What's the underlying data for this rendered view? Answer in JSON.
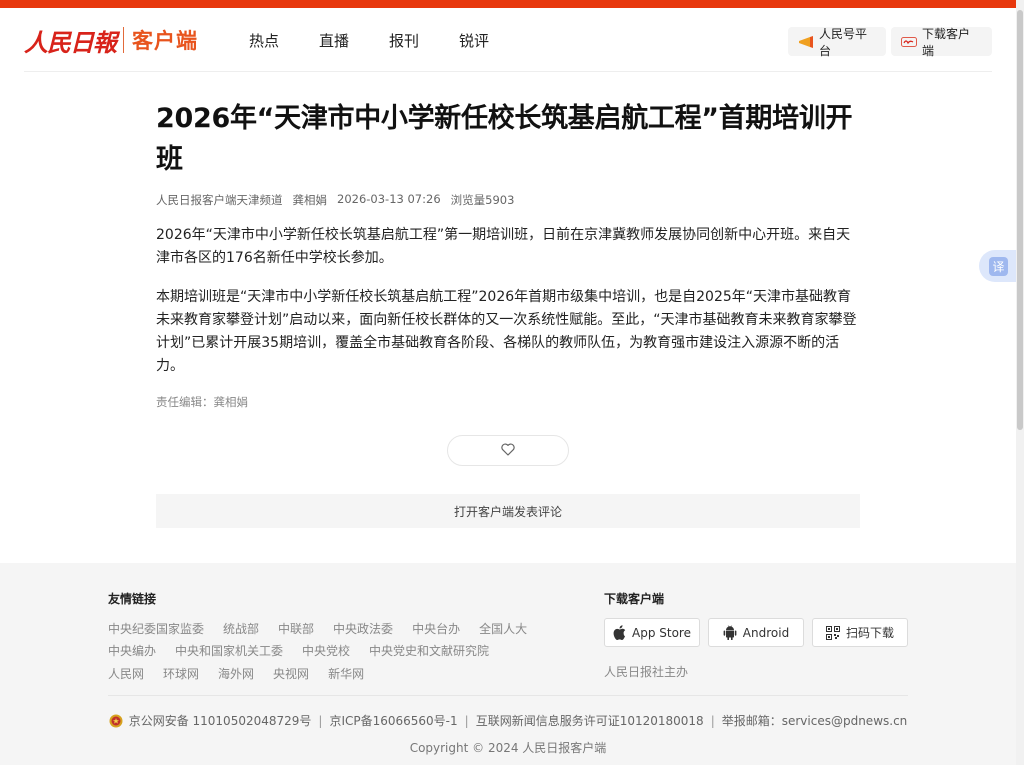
{
  "brand": {
    "logo_text": "人民日報",
    "name": "客户端",
    "accent_color": "#e8380d"
  },
  "nav": {
    "items": [
      {
        "label": "热点"
      },
      {
        "label": "直播"
      },
      {
        "label": "报刊"
      },
      {
        "label": "锐评"
      }
    ]
  },
  "header_buttons": {
    "platform_label": "人民号平台",
    "download_label": "下载客户端"
  },
  "article": {
    "title": "2026年“天津市中小学新任校长筑基启航工程”首期培训开班",
    "source": "人民日报客户端天津频道",
    "author": "龚相娟",
    "datetime": "2026-03-13 07:26",
    "views": "浏览量5903",
    "paragraphs": [
      "2026年“天津市中小学新任校长筑基启航工程”第一期培训班，日前在京津冀教师发展协同创新中心开班。来自天津市各区的176名新任中学校长参加。",
      "本期培训班是“天津市中小学新任校长筑基启航工程”2026年首期市级集中培训，也是自2025年“天津市基础教育未来教育家攀登计划”启动以来，面向新任校长群体的又一次系统性赋能。至此，“天津市基础教育未来教育家攀登计划”已累计开展35期培训，覆盖全市基础教育各阶段、各梯队的教师队伍，为教育强市建设注入源源不断的活力。"
    ],
    "editor": "责任编辑：龚相娟"
  },
  "like": {
    "icon": "heart-icon"
  },
  "comment": {
    "label": "打开客户端发表评论"
  },
  "translate": {
    "label": "译"
  },
  "footer": {
    "links_title": "友情链接",
    "links_rows": [
      [
        "中央纪委国家监委",
        "统战部",
        "中联部",
        "中央政法委",
        "中央台办",
        "全国人大"
      ],
      [
        "中央编办",
        "中央和国家机关工委",
        "中央党校",
        "中央党史和文献研究院"
      ],
      [
        "人民网",
        "环球网",
        "海外网",
        "央视网",
        "新华网"
      ]
    ],
    "download_title": "下载客户端",
    "download_buttons": [
      {
        "label": "App Store",
        "icon": "apple-icon"
      },
      {
        "label": "Android",
        "icon": "android-icon"
      },
      {
        "label": "扫码下载",
        "icon": "qr-code-icon"
      }
    ],
    "sponsor": "人民日报社主办",
    "legal": {
      "police": "京公网安备 11010502048729号",
      "icp": "京ICP备16066560号-1",
      "license": "互联网新闻信息服务许可证10120180018",
      "report": "举报邮箱：services@pdnews.cn"
    },
    "copyright": "Copyright © 2024 人民日报客户端"
  }
}
